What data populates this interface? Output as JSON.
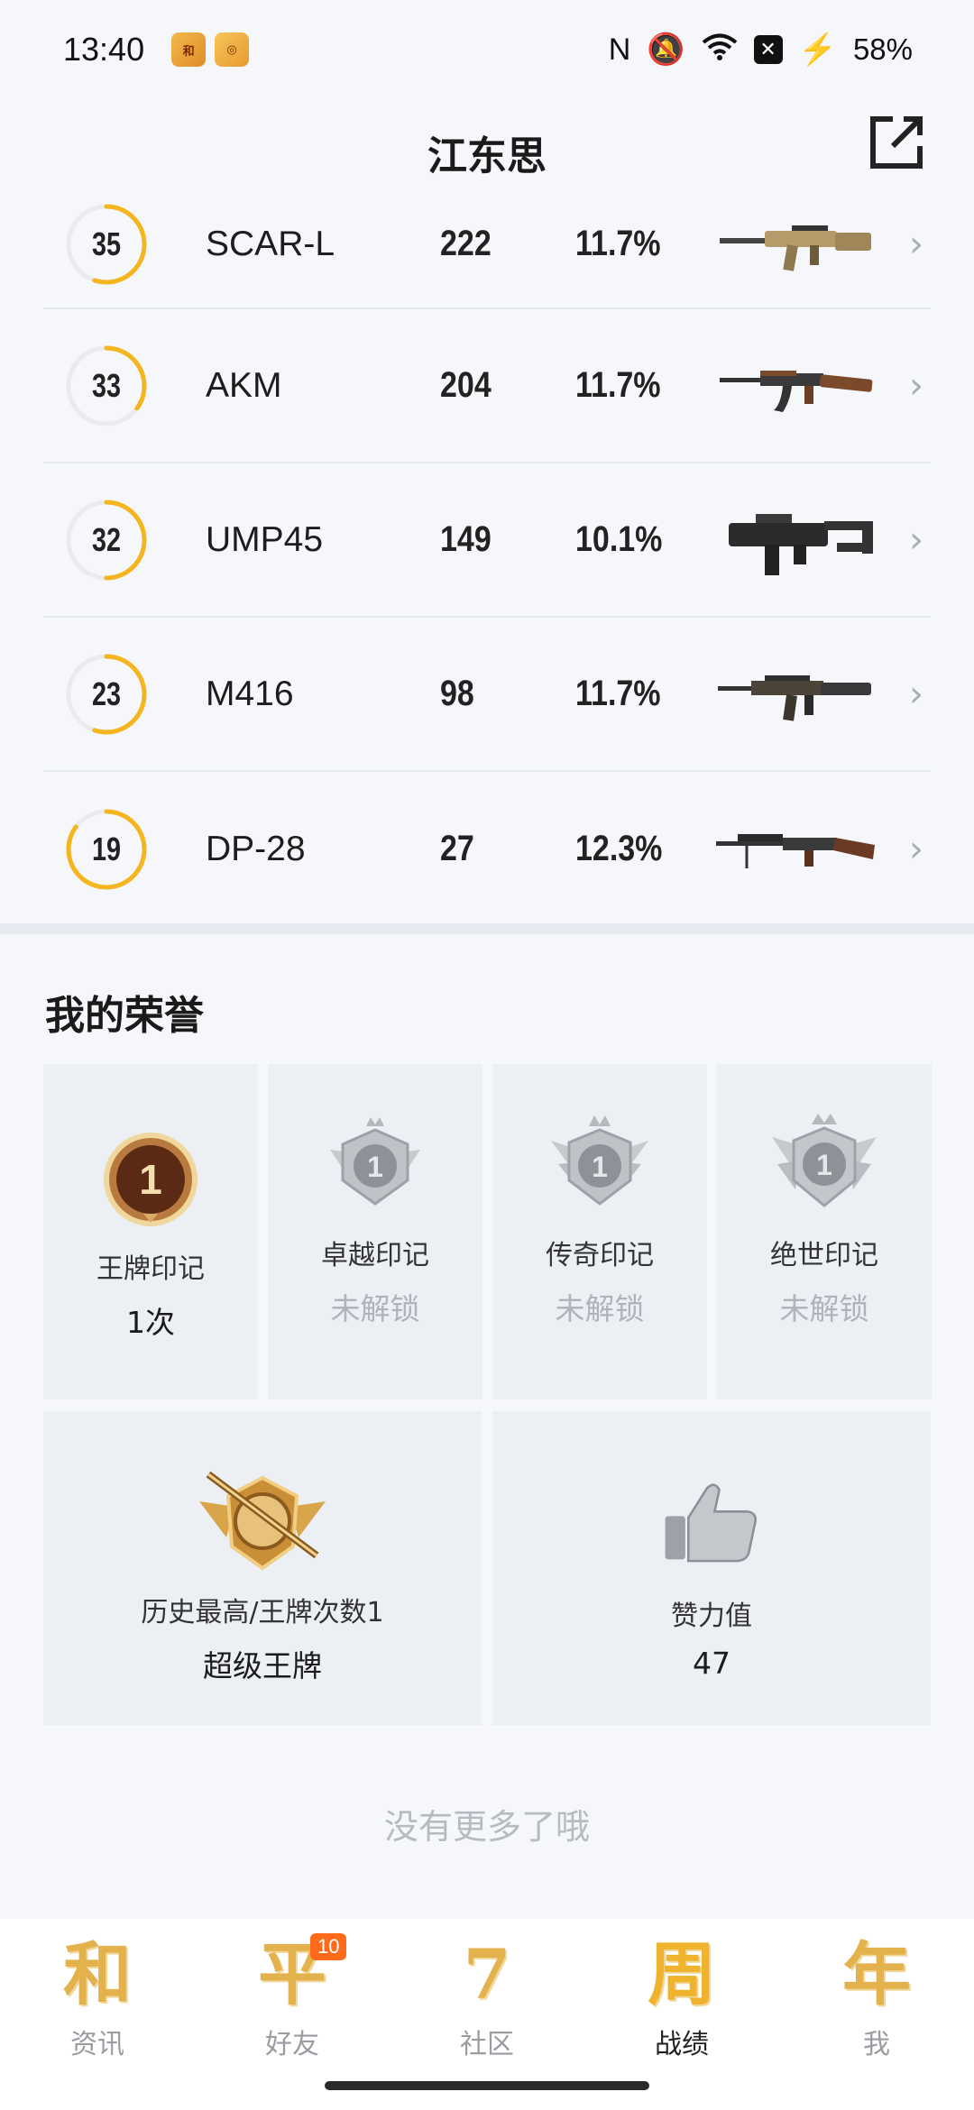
{
  "status_bar": {
    "time": "13:40",
    "battery": "58%",
    "icons": [
      "nfc-icon",
      "mute-icon",
      "wifi-icon",
      "x-box-icon",
      "charging-icon"
    ]
  },
  "header": {
    "title": "江东思"
  },
  "weapons": [
    {
      "level": "35",
      "name": "SCAR-L",
      "kills": "222",
      "rate": "11.7%",
      "progress": 0.55,
      "icon": "scar-l-rifle"
    },
    {
      "level": "33",
      "name": "AKM",
      "kills": "204",
      "rate": "11.7%",
      "progress": 0.35,
      "icon": "akm-rifle"
    },
    {
      "level": "32",
      "name": "UMP45",
      "kills": "149",
      "rate": "10.1%",
      "progress": 0.5,
      "icon": "ump45-smg"
    },
    {
      "level": "23",
      "name": "M416",
      "kills": "98",
      "rate": "11.7%",
      "progress": 0.55,
      "icon": "m416-rifle"
    },
    {
      "level": "19",
      "name": "DP-28",
      "kills": "27",
      "rate": "12.3%",
      "progress": 0.85,
      "icon": "dp28-lmg"
    }
  ],
  "honor": {
    "title": "我的荣誉",
    "marks": [
      {
        "label": "王牌印记",
        "value": "1次",
        "locked": false,
        "icon": "ace-mark-badge"
      },
      {
        "label": "卓越印记",
        "value": "未解锁",
        "locked": true,
        "icon": "excellence-mark-badge"
      },
      {
        "label": "传奇印记",
        "value": "未解锁",
        "locked": true,
        "icon": "legend-mark-badge"
      },
      {
        "label": "绝世印记",
        "value": "未解锁",
        "locked": true,
        "icon": "peerless-mark-badge"
      }
    ],
    "highest": {
      "label": "历史最高/王牌次数1",
      "value": "超级王牌",
      "icon": "super-ace-badge"
    },
    "likes": {
      "label": "赞力值",
      "value": "47",
      "icon": "thumbs-up-icon"
    }
  },
  "footer_note": "没有更多了哦",
  "bottom_nav": [
    {
      "glyph": "和",
      "label": "资讯",
      "active": false
    },
    {
      "glyph": "平",
      "label": "好友",
      "active": false,
      "badge": "10"
    },
    {
      "glyph": "7",
      "label": "社区",
      "active": false
    },
    {
      "glyph": "周",
      "label": "战绩",
      "active": true
    },
    {
      "glyph": "年",
      "label": "我",
      "active": false
    }
  ],
  "colors": {
    "ring_progress": "#f5b51e",
    "ring_track": "#e9ebef",
    "accent_gold": "#e4b24d",
    "badge_orange": "#ff6b1a"
  }
}
